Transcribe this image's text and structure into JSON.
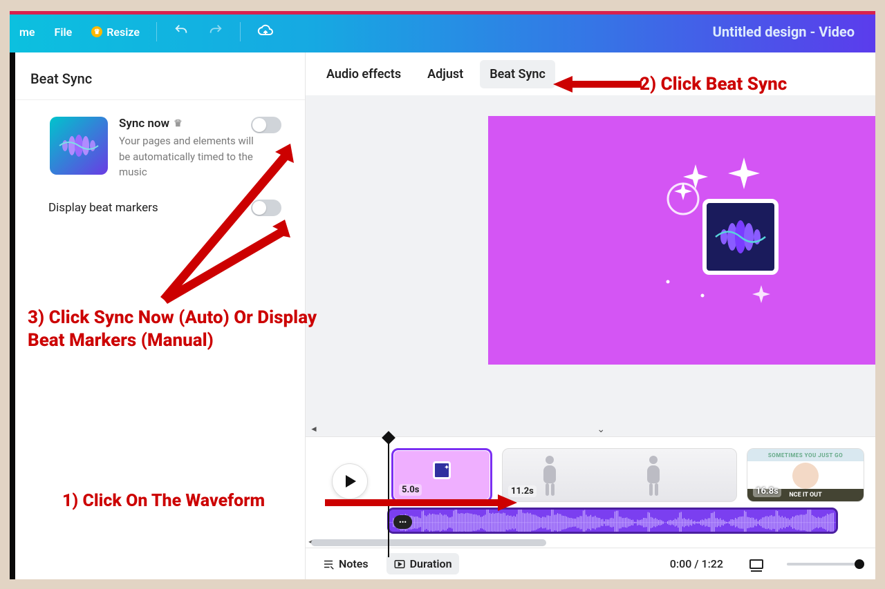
{
  "appbar": {
    "home": "me",
    "file": "File",
    "resize": "Resize",
    "title": "Untitled design - Video"
  },
  "sidebar": {
    "title": "Beat Sync",
    "sync": {
      "title": "Sync now",
      "desc": "Your pages and elements will be automatically timed to the music"
    },
    "display_beat": "Display beat markers"
  },
  "tabs": {
    "audio_effects": "Audio effects",
    "adjust": "Adjust",
    "beat_sync": "Beat Sync"
  },
  "timeline": {
    "clip1_dur": "5.0s",
    "clip2_dur": "11.2s",
    "clip3_dur": "16.8s",
    "clip3_top": "SOMETIMES YOU JUST GO",
    "clip3_bot": "NCE IT OUT"
  },
  "footer": {
    "notes": "Notes",
    "duration": "Duration",
    "time": "0:00 / 1:22"
  },
  "annotations": {
    "step1": "1) Click On The Waveform",
    "step2": "2) Click Beat Sync",
    "step3": "3) Click Sync Now (Auto) Or Display Beat Markers (Manual)"
  }
}
